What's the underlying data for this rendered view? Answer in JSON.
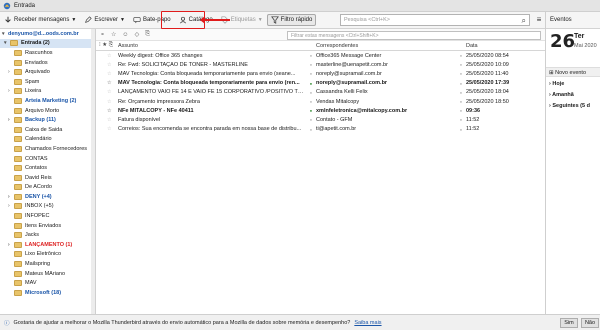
{
  "titlebar": {
    "tab_label": "Entrada"
  },
  "toolbar": {
    "receive_label": "Receber mensagens",
    "write_label": "Escrever",
    "chat_label": "Bate-papo",
    "catalog_label": "Catálogo",
    "tags_label": "Etiquetas",
    "quickfilter_label": "Filtro rápido",
    "search_placeholder": "Pesquisa <Ctrl+K>"
  },
  "folders": {
    "account": "denyumo@d...oods.com.br",
    "items": [
      {
        "label": "Entrada (2)",
        "style": "sel"
      },
      {
        "label": "Rascunhos",
        "style": ""
      },
      {
        "label": "Enviados",
        "style": ""
      },
      {
        "label": "Arquivado",
        "style": ""
      },
      {
        "label": "Spam",
        "style": ""
      },
      {
        "label": "Lixeira",
        "style": ""
      },
      {
        "label": "Arteia Marketing (2)",
        "style": "blue"
      },
      {
        "label": "Arquivo Morto",
        "style": ""
      },
      {
        "label": "Backup (11)",
        "style": "blue"
      },
      {
        "label": "Caixa de Saida",
        "style": ""
      },
      {
        "label": "Calendário",
        "style": ""
      },
      {
        "label": "Chamados Fornecedores",
        "style": ""
      },
      {
        "label": "CONTAS",
        "style": ""
      },
      {
        "label": "Contatos",
        "style": ""
      },
      {
        "label": "David Reis",
        "style": ""
      },
      {
        "label": "De ACordo",
        "style": ""
      },
      {
        "label": "DENY (+4)",
        "style": "blue"
      },
      {
        "label": "INBOX (+5)",
        "style": ""
      },
      {
        "label": "INFOPEC",
        "style": ""
      },
      {
        "label": "Itens Enviados",
        "style": ""
      },
      {
        "label": "Jacks",
        "style": ""
      },
      {
        "label": "LANÇAMENTO (1)",
        "style": "red"
      },
      {
        "label": "Lixo Eletrônico",
        "style": ""
      },
      {
        "label": "Mailspring",
        "style": ""
      },
      {
        "label": "Mateus MAriano",
        "style": ""
      },
      {
        "label": "MAV",
        "style": ""
      },
      {
        "label": "Microsoft (18)",
        "style": "blue"
      }
    ]
  },
  "quickfilter": {
    "placeholder": "Filtrar estas mensagens <Ctrl+Shift+K>"
  },
  "columns": {
    "subject": "Assunto",
    "correspondents": "Correspondentes",
    "date": "Data"
  },
  "messages": [
    {
      "subject": "Weekly digest: Office 365 changes",
      "from": "Office365 Message Center",
      "date": "25/05/2020 08:54",
      "unread": false
    },
    {
      "subject": "Re: Fwd: SOLICITAÇÃO DE TONER - MASTERLINE",
      "from": "masterline@uenapetit.com.br",
      "date": "25/05/2020 10:09",
      "unread": false
    },
    {
      "subject": "MAV Tecnologia: Conta bloqueada temporariamente para envio (seane...",
      "from": "noreply@supramail.com.br",
      "date": "25/05/2020 11:40",
      "unread": false
    },
    {
      "subject": "MAV Tecnologia: Conta bloqueada temporariamente para envio (ren...",
      "from": "noreply@supramail.com.br",
      "date": "25/05/2020 17:39",
      "unread": true
    },
    {
      "subject": "LANÇAMENTO VAIO FE 14 E VAIO FE 15 CORPORATIVO  /POSITIVO TEC...",
      "from": "Cassandra Kelli Felix",
      "date": "25/05/2020 18:04",
      "unread": false
    },
    {
      "subject": "Re: Orçamento impressora Zebra",
      "from": "Vendas Mitalcopy",
      "date": "25/05/2020 18:50",
      "unread": false
    },
    {
      "subject": "NFe MITALCOPY - NFe 40411",
      "from": "xmlnfeletronica@mitalcopy.com.br",
      "date": "09:36",
      "unread": true
    },
    {
      "subject": "Fatura disponível",
      "from": "Contato - GFM",
      "date": "11:52",
      "unread": false
    },
    {
      "subject": "Correios: Sua encomenda se encontra parada em nossa base de distribu...",
      "from": "ti@apetit.com.br",
      "date": "11:52",
      "unread": false
    }
  ],
  "today_pane": {
    "header": "Eventos",
    "day_number": "26",
    "day_name": "Ter",
    "month_year": "Mai 2020",
    "new_event_label": "Novo evento",
    "groups": [
      "Hoje",
      "Amanhã",
      "Seguintes (5 d"
    ]
  },
  "statusbar": {
    "message": "Gostaria de ajudar a melhorar o Mozilla Thunderbird através do envio automático para a Mozilla de dados sobre memória e desempenho?",
    "link": "Saiba mais",
    "yes_label": "Sim",
    "no_label": "Não"
  },
  "colors": {
    "accent": "#1a55a8",
    "highlight_box": "#e01b1b",
    "selected_row": "#d6e4f4"
  }
}
